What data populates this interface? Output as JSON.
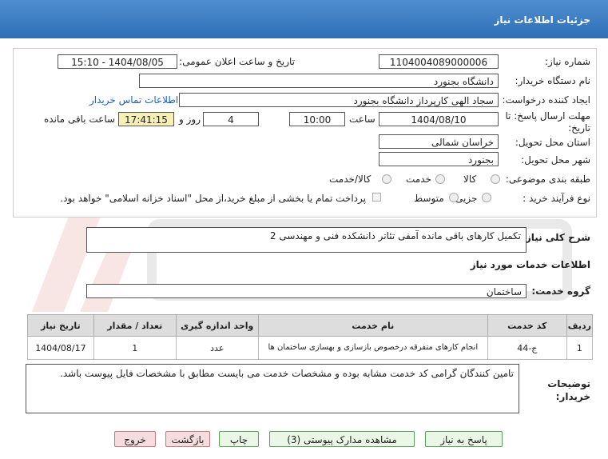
{
  "header": {
    "title": "جزئیات اطلاعات نیاز"
  },
  "form": {
    "need_number_label": "شماره نیاز:",
    "need_number": "1104004089000006",
    "announce_label": "تاریخ و ساعت اعلان عمومی:",
    "announce_value": "1404/08/05 - 15:10",
    "buyer_org_label": "نام دستگاه خریدار:",
    "buyer_org": "دانشگاه بجنورد",
    "requester_label": "ایجاد کننده درخواست:",
    "requester": "سجاد الهی کارپرداز دانشگاه بجنورد",
    "contact_link": "اطلاعات تماس خریدار",
    "deadline_label_1": "مهلت ارسال پاسخ: تا",
    "deadline_label_2": "تاریخ:",
    "deadline_date": "1404/08/10",
    "time_label": "ساعت",
    "deadline_time": "10:00",
    "days_value": "4",
    "days_label": "روز و",
    "remaining_time": "17:41:15",
    "remaining_label": "ساعت باقی مانده",
    "province_label": "استان محل تحویل:",
    "province": "خراسان شمالی",
    "city_label": "شهر محل تحویل:",
    "city": "بجنورد",
    "category_label": "طبقه بندی موضوعی:",
    "category_options": [
      "کالا",
      "خدمت",
      "کالا/خدمت"
    ],
    "process_label": "نوع فرآیند خرید :",
    "process_options": [
      "جزیی",
      "متوسط"
    ],
    "payment_note": "پرداخت تمام یا بخشی از مبلغ خرید،از محل \"اسناد خزانه اسلامی\" خواهد بود."
  },
  "summary": {
    "label": "شرح کلی نیاز:",
    "value": "تکمیل کارهای باقی مانده آمفی تئاتر دانشکده فنی و مهندسی 2"
  },
  "services": {
    "section_title": "اطلاعات خدمات مورد نیاز",
    "group_label": "گروه خدمت:",
    "group_value": "ساختمان",
    "columns": [
      "ردیف",
      "کد خدمت",
      "نام خدمت",
      "واحد اندازه گیری",
      "تعداد / مقدار",
      "تاریخ نیاز"
    ],
    "rows": [
      {
        "row": "1",
        "code": "ج-44",
        "name": "انجام کارهای متفرقه درخصوص بازسازی و بهسازی ساختمان ها",
        "unit": "عدد",
        "qty": "1",
        "date": "1404/08/17"
      }
    ]
  },
  "buyer_notes": {
    "label_1": "توضیحات",
    "label_2": "خریدار:",
    "value": "تامین کنندگان گرامی کد خدمت مشابه بوده و مشخصات خدمت می بایست مطابق با مشخصات فایل پیوست باشد."
  },
  "buttons": {
    "reply": "پاسخ به نیاز",
    "attachments": "مشاهده مدارک پیوستی (3)",
    "print": "چاپ",
    "back": "بازگشت",
    "exit": "خروج"
  }
}
